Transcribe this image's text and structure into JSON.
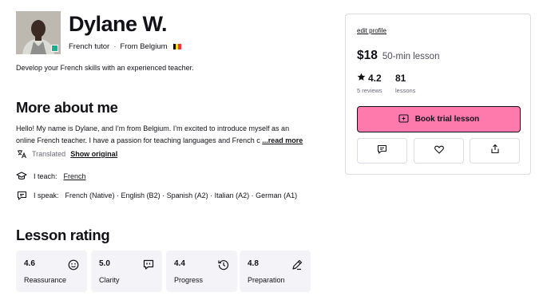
{
  "profile": {
    "name": "Dylane W.",
    "role": "French tutor",
    "from": "From Belgium",
    "headline": "Develop your French skills with an experienced teacher."
  },
  "about": {
    "heading": "More about me",
    "line1": "Hello! My name is Dylane, and I'm from Belgium. I'm excited to introduce myself as an",
    "line2": "online French teacher. I have a passion for teaching languages and French c",
    "read_more": "...read more",
    "translated_label": "Translated",
    "show_original": "Show original",
    "teach_label": "I teach:",
    "teach_value": "French",
    "speak_label": "I speak:",
    "speak_value": "French (Native) · English (B2) · Spanish (A2) · Italian (A2) · German (A1)"
  },
  "rating": {
    "heading": "Lesson rating",
    "items": [
      {
        "value": "4.6",
        "label": "Reassurance",
        "icon": "smile-icon"
      },
      {
        "value": "5.0",
        "label": "Clarity",
        "icon": "chat-quote-icon"
      },
      {
        "value": "4.4",
        "label": "Progress",
        "icon": "history-icon"
      },
      {
        "value": "4.8",
        "label": "Preparation",
        "icon": "pencil-icon"
      }
    ]
  },
  "sidebar": {
    "edit_profile": "edit profile",
    "price": "$18",
    "price_note": "50-min lesson",
    "rating_value": "4.2",
    "reviews": "5 reviews",
    "lessons_count": "81",
    "lessons_label": "lessons",
    "book_label": "Book trial lesson"
  },
  "colors": {
    "accent_pink": "#ff7aac",
    "online_green": "#1cae8b",
    "flag": [
      "#000000",
      "#fdda24",
      "#ef3340"
    ]
  }
}
